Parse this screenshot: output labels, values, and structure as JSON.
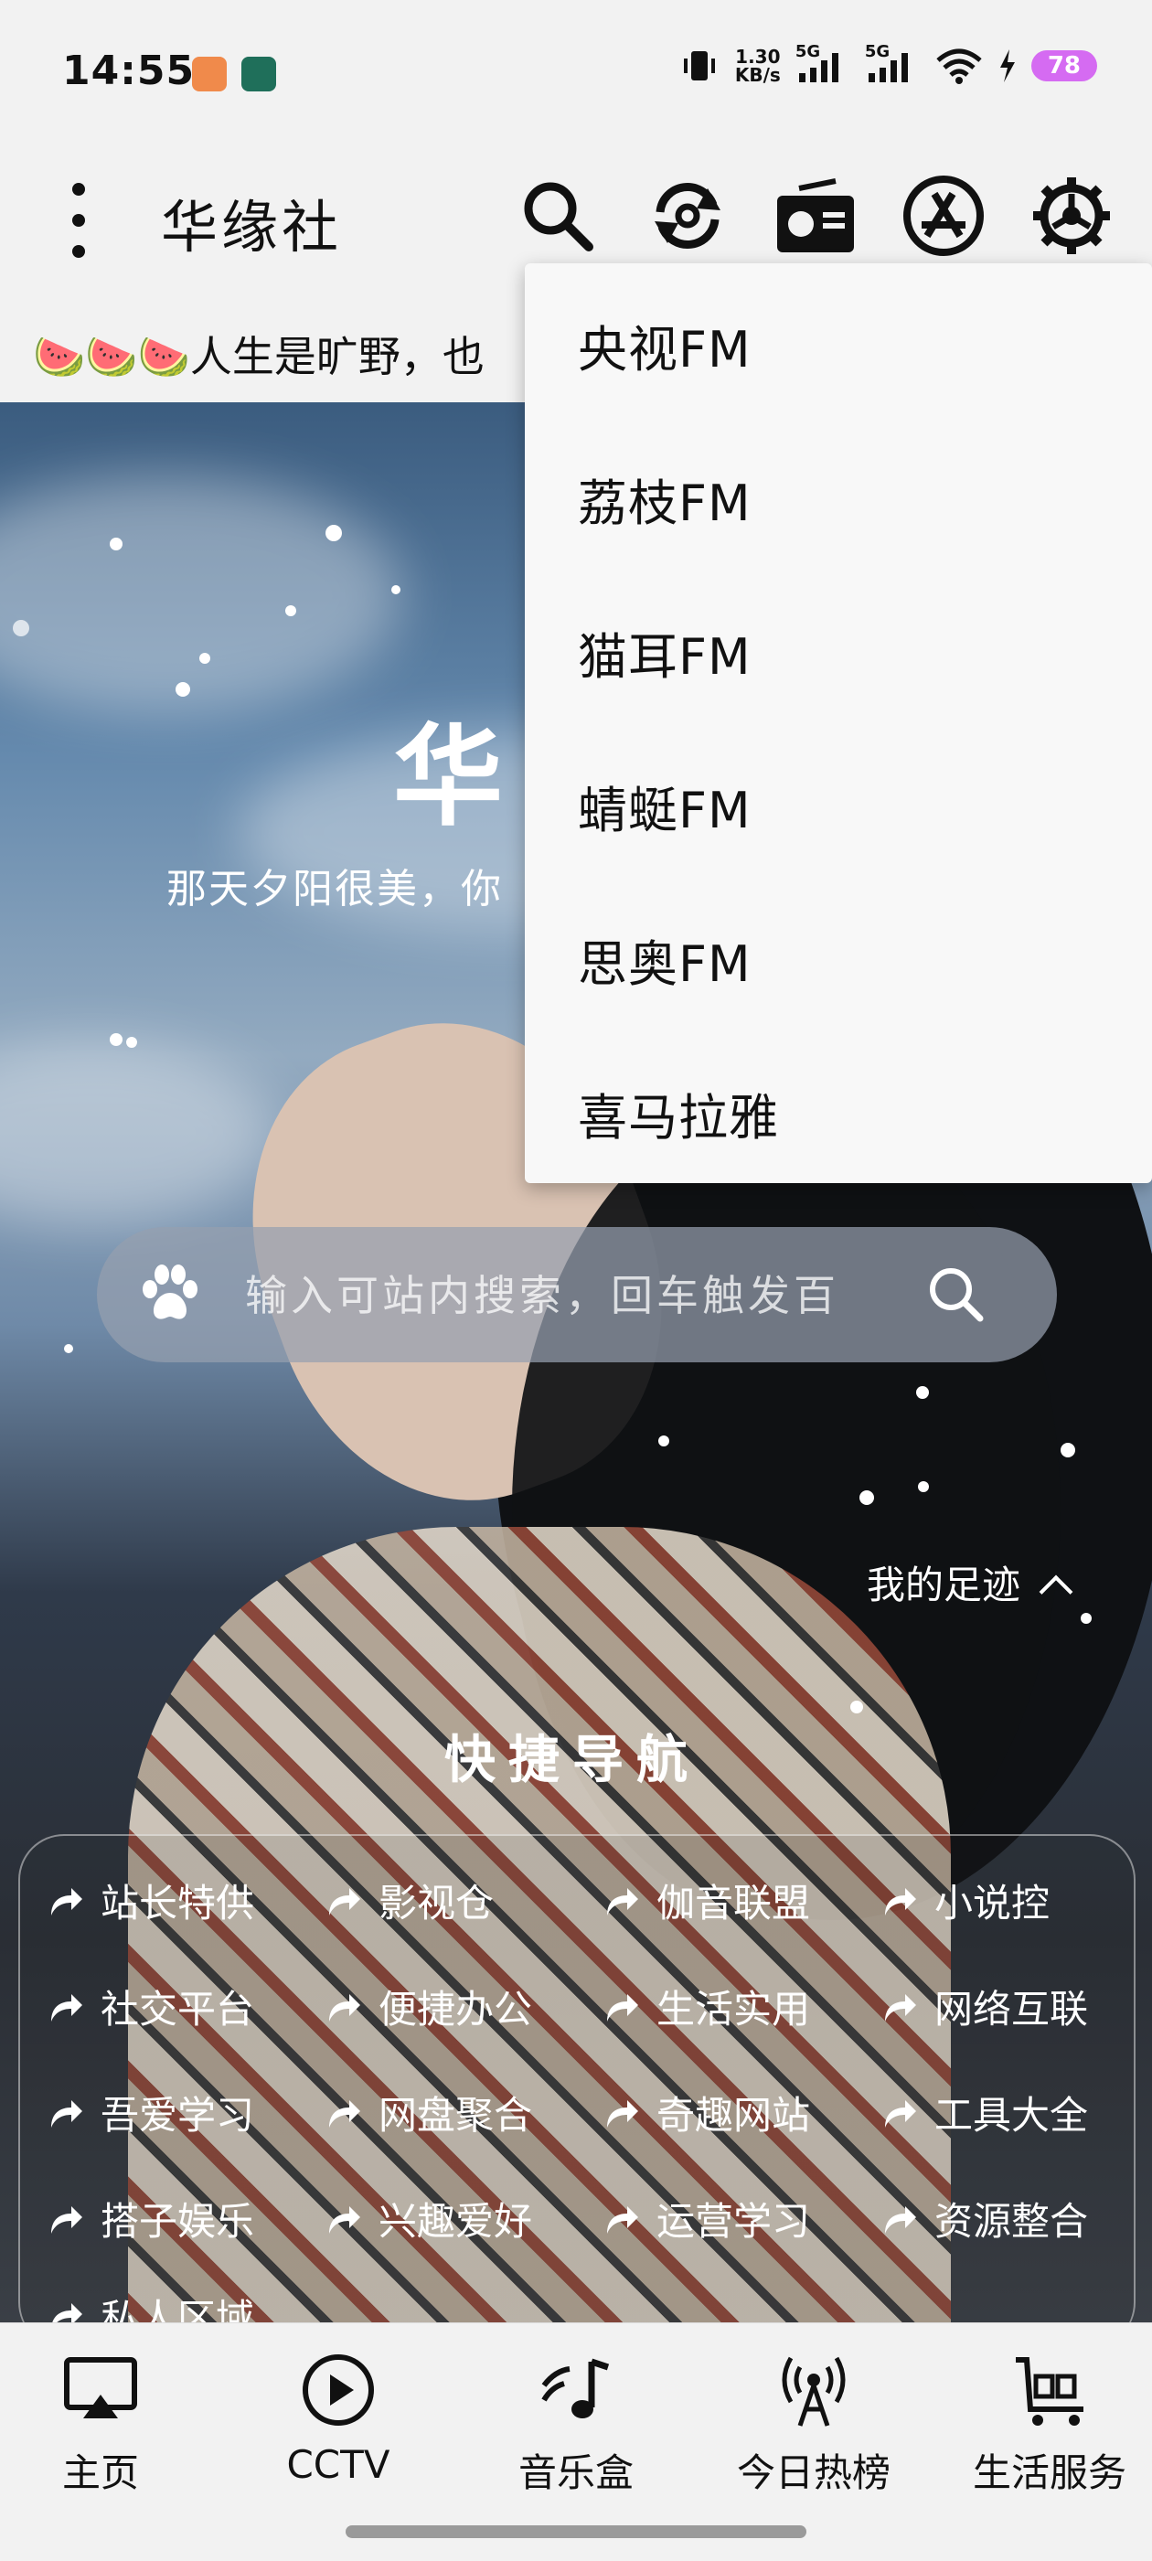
{
  "status": {
    "time": "14:55",
    "net_speed_value": "1.30",
    "net_speed_unit": "KB/s",
    "sim1": "5G",
    "sim2": "5G",
    "battery": "78"
  },
  "appbar": {
    "title": "华缘社",
    "icons": [
      "more-vertical-icon",
      "search-icon",
      "refresh-icon",
      "radio-icon",
      "app-store-icon",
      "settings-icon"
    ]
  },
  "marquee": {
    "text": "🍉🍉🍉人生是旷野，也"
  },
  "hero": {
    "title": "华",
    "subtitle": "那天夕阳很美，你"
  },
  "search": {
    "placeholder": "输入可站内搜索，回车触发百"
  },
  "footprint": {
    "label": "我的足迹"
  },
  "quick_nav": {
    "title": "快捷导航",
    "items": [
      "站长特供",
      "影视仓",
      "伽音联盟",
      "小说控",
      "社交平台",
      "便捷办公",
      "生活实用",
      "网络互联",
      "吾爱学习",
      "网盘聚合",
      "奇趣网站",
      "工具大全",
      "搭子娱乐",
      "兴趣爱好",
      "运营学习",
      "资源整合",
      "私人区域"
    ]
  },
  "radio_menu": {
    "items": [
      "央视FM",
      "荔枝FM",
      "猫耳FM",
      "蜻蜓FM",
      "思奥FM",
      "喜马拉雅"
    ]
  },
  "bottom_nav": {
    "items": [
      {
        "label": "主页",
        "icon": "airplay-icon"
      },
      {
        "label": "CCTV",
        "icon": "play-circle-icon"
      },
      {
        "label": "音乐盒",
        "icon": "music-note-icon"
      },
      {
        "label": "今日热榜",
        "icon": "broadcast-tower-icon"
      },
      {
        "label": "生活服务",
        "icon": "cart-icon"
      }
    ]
  },
  "colors": {
    "accent_battery": "#d56bf2",
    "menu_bg": "#f8f8f8",
    "bar_bg": "#f2f2f2"
  }
}
